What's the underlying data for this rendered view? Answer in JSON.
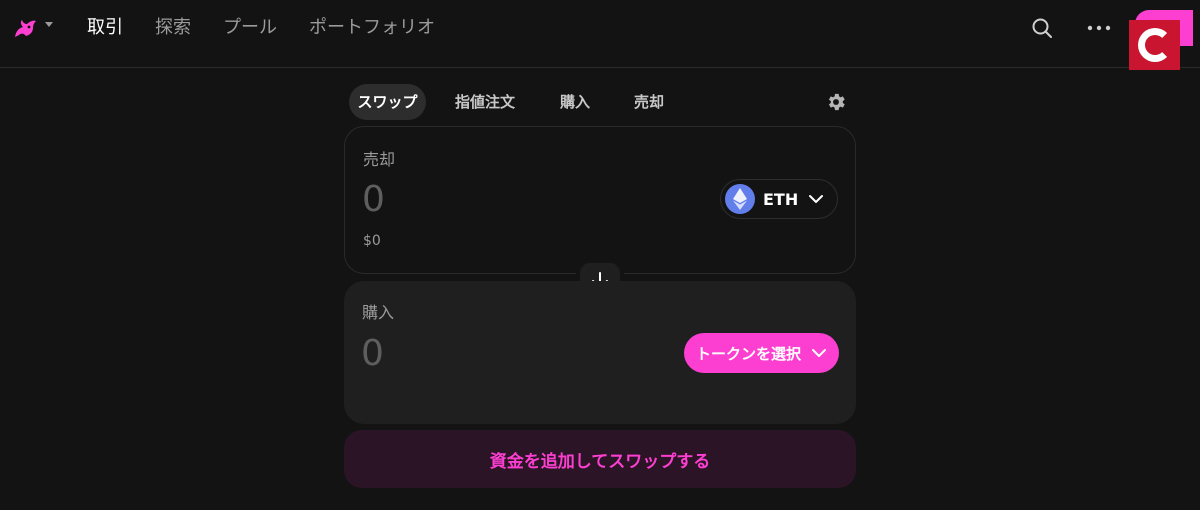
{
  "nav": {
    "items": [
      {
        "label": "取引",
        "active": true
      },
      {
        "label": "探索",
        "active": false
      },
      {
        "label": "プール",
        "active": false
      },
      {
        "label": "ポートフォリオ",
        "active": false
      }
    ],
    "icons": [
      "unicorn-logo-icon",
      "search-icon",
      "more-icon"
    ]
  },
  "swap": {
    "tabs": [
      "スワップ",
      "指値注文",
      "購入",
      "売却"
    ],
    "active_tab": "スワップ",
    "sell": {
      "label": "売却",
      "amount_placeholder": "0",
      "usd_value": "$0",
      "token_symbol": "ETH"
    },
    "buy": {
      "label": "購入",
      "amount_placeholder": "0",
      "select_token_label": "トークンを選択"
    },
    "cta_label": "資金を追加してスワップする"
  },
  "colors": {
    "background": "#131313",
    "accent": "#fc3fd1",
    "eth": "#627eea",
    "badge": "#c9152f"
  }
}
